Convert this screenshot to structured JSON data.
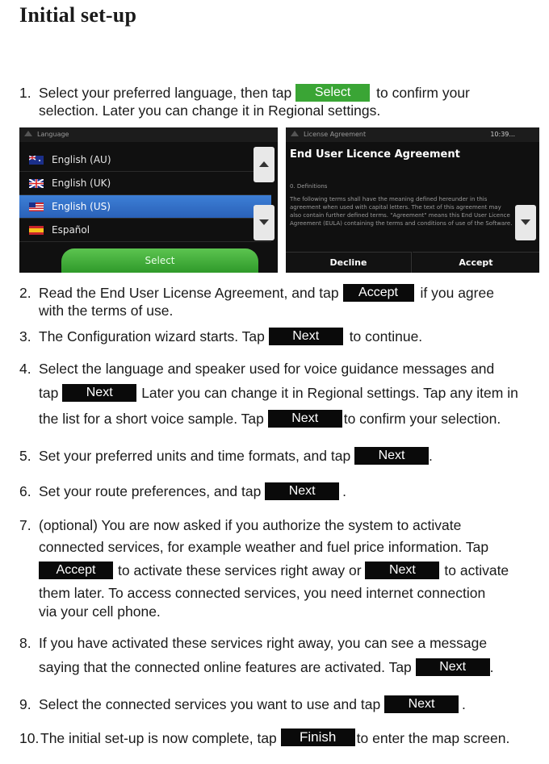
{
  "title": "Initial set-up",
  "buttons": {
    "select": "Select",
    "accept": "Accept",
    "next": "Next",
    "finish": "Finish"
  },
  "colors": {
    "select_chip": "#3aa535",
    "dark_chip": "#0a0a0a",
    "highlight_row": "#2f6bc4"
  },
  "steps": [
    {
      "num": "1.",
      "lines": [
        [
          "Select your preferred language, then tap ",
          "to confirm your"
        ],
        [
          "selection. Later you can change it in Regional settings."
        ]
      ]
    },
    {
      "num": "2.",
      "lines": [
        [
          "Read the End User License Agreement, and tap ",
          "if you agree"
        ],
        [
          "with the terms of use."
        ]
      ]
    },
    {
      "num": "3.",
      "lines": [
        [
          "The Configuration wizard starts. Tap ",
          "to continue."
        ]
      ]
    },
    {
      "num": "4.",
      "lines": [
        [
          "Select the language and speaker used for voice guidance messages and"
        ],
        [
          "tap ",
          "Later you can change it in Regional settings. Tap any item in"
        ],
        [
          "the list for a short voice sample. Tap ",
          "to confirm your selection."
        ]
      ]
    },
    {
      "num": "5.",
      "lines": [
        [
          "Set your preferred units and time formats, and tap ",
          "."
        ]
      ]
    },
    {
      "num": "6.",
      "lines": [
        [
          "Set your route preferences, and tap ",
          "."
        ]
      ]
    },
    {
      "num": "7.",
      "lines": [
        [
          "(optional) You are now asked if you authorize the system to activate"
        ],
        [
          "connected services, for example weather and fuel price information. Tap"
        ],
        [
          "to activate these services right away or ",
          "to activate"
        ],
        [
          "them later. To access connected services, you need internet connection"
        ],
        [
          "via your cell phone."
        ]
      ]
    },
    {
      "num": "8.",
      "lines": [
        [
          "If you have activated these services right away, you can see a message"
        ],
        [
          "saying that the connected online features are activated. Tap ",
          "."
        ]
      ]
    },
    {
      "num": "9.",
      "lines": [
        [
          "Select the connected services you want to use and tap ",
          "."
        ]
      ]
    },
    {
      "num": "10.",
      "lines": [
        [
          "The initial set-up is now complete, tap ",
          "to enter the map screen."
        ]
      ]
    }
  ],
  "language_screen": {
    "header": "Language",
    "items": [
      "English (AU)",
      "English (UK)",
      "English (US)",
      "Español"
    ],
    "selected_index": 2,
    "button": "Select"
  },
  "eula_screen": {
    "header": "License Agreement",
    "time": "10:39...",
    "title": "End User Licence Agreement",
    "section": "0. Definitions",
    "body": "The following terms shall have the meaning defined hereunder in this agreement when used with capital letters. The text of this agreement may also contain further defined terms. \"Agreement\" means this End User Licence Agreement (EULA) containing the terms and conditions of use of the Software.",
    "decline": "Decline",
    "accept": "Accept"
  }
}
